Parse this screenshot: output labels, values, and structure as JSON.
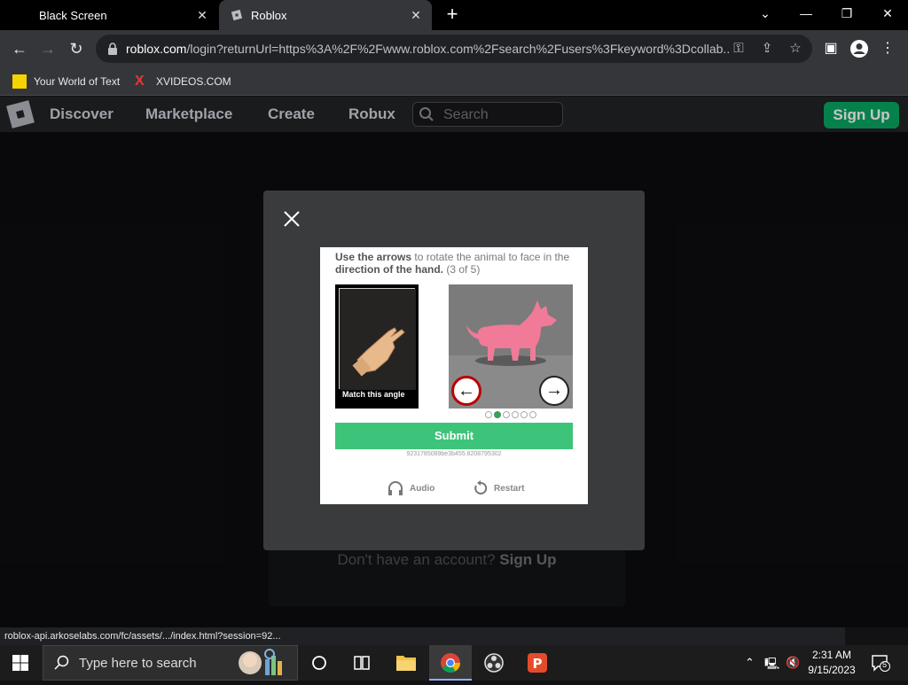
{
  "browser": {
    "tabs": [
      {
        "title": "Black Screen",
        "active": false
      },
      {
        "title": "Roblox",
        "active": true
      }
    ],
    "url_host": "roblox.com",
    "url_rest": "/login?returnUrl=https%3A%2F%2Fwww.roblox.com%2Fsearch%2Fusers%3Fkeyword%3Dcollab...",
    "bookmarks": [
      {
        "label": "Your World of Text"
      },
      {
        "label": "XVIDEOS.COM"
      }
    ],
    "status_url": "roblox-api.arkoselabs.com/fc/assets/.../index.html?session=92..."
  },
  "roblox": {
    "nav": [
      "Discover",
      "Marketplace",
      "Create",
      "Robux"
    ],
    "search_placeholder": "Search",
    "signup_button": "Sign Up",
    "no_account_text": "Don't have an account?",
    "no_account_link": "Sign Up"
  },
  "captcha": {
    "instruction_1": "Use the arrows",
    "instruction_2": " to rotate the animal",
    "instruction_3": " to face in the ",
    "instruction_4": "direction of the hand.",
    "instruction_5": " (3 of 5)",
    "hand_label": "Match this angle",
    "submit_label": "Submit",
    "session_id": "9231785089be3b455.8208795302",
    "audio_label": "Audio",
    "restart_label": "Restart",
    "current_step": 2,
    "total_steps": 6
  },
  "taskbar": {
    "search_placeholder": "Type here to search",
    "time": "2:31 AM",
    "date": "9/15/2023",
    "notification_count": "5"
  },
  "colors": {
    "roblox_bg": "#121215",
    "submit_green": "#3ec47a",
    "signup_green": "#00a35c"
  }
}
